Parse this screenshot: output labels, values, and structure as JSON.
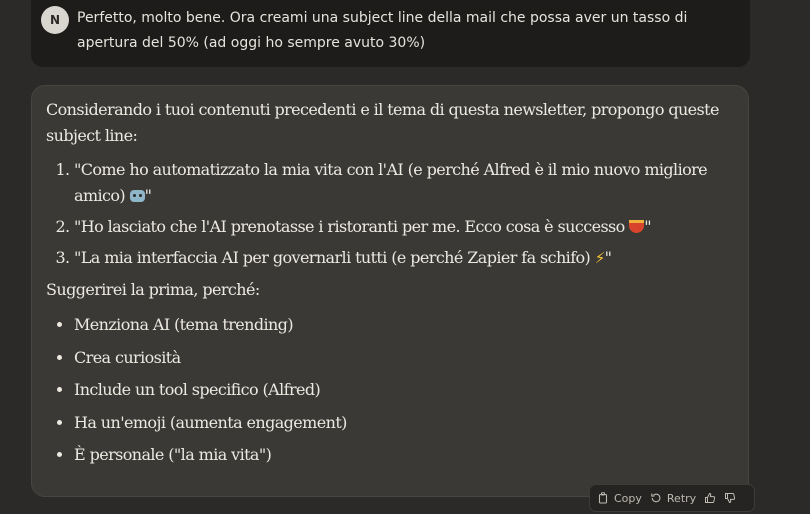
{
  "user_message": {
    "avatar_initial": "N",
    "text": "Perfetto, molto bene. Ora creami una subject line della mail che possa aver un tasso di apertura del 50% (ad oggi ho sempre avuto 30%)"
  },
  "assistant_message": {
    "intro": "Considerando i tuoi contenuti precedenti e il tema di questa newsletter, propongo queste subject line:",
    "subject_lines": [
      {
        "text": "\"Come ho automatizzato la mia vita con l'AI (e perché Alfred è il mio nuovo migliore amico) ",
        "emoji": "robot-icon",
        "end": "\""
      },
      {
        "text": "\"Ho lasciato che l'AI prenotasse i ristoranti per me. Ecco cosa è successo ",
        "emoji": "spaghetti-icon",
        "end": "\""
      },
      {
        "text": "\"La mia interfaccia AI per governarli tutti (e perché Zapier fa schifo) ",
        "emoji": "lightning-icon",
        "end": "\""
      }
    ],
    "suggestion": "Suggerirei la prima, perché:",
    "reasons": [
      "Menziona AI (tema trending)",
      "Crea curiosità",
      "Include un tool specifico (Alfred)",
      "Ha un'emoji (aumenta engagement)",
      "È personale (\"la mia vita\")"
    ]
  },
  "actions": {
    "copy_label": "Copy",
    "retry_label": "Retry"
  },
  "icons": {
    "lightning_glyph": "⚡"
  },
  "colors": {
    "background": "#2b2a28",
    "user_bubble": "#1d1c1b",
    "assistant_bubble": "#3a3936",
    "text": "#ece9e1"
  }
}
